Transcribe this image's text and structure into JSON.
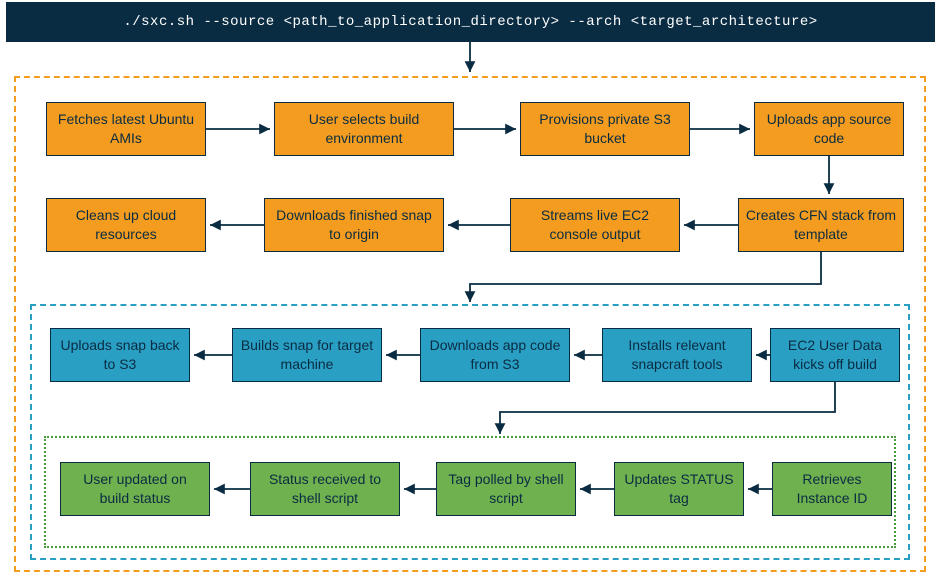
{
  "command": "./sxc.sh --source <path_to_application_directory> --arch <target_architecture>",
  "row1": {
    "b1": "Fetches latest Ubuntu AMIs",
    "b2": "User selects build environment",
    "b3": "Provisions private S3 bucket",
    "b4": "Uploads app source code"
  },
  "row2": {
    "b1": "Cleans up cloud resources",
    "b2": "Downloads finished snap to origin",
    "b3": "Streams live EC2 console output",
    "b4": "Creates CFN stack from template"
  },
  "row3": {
    "b1": "Uploads snap back to S3",
    "b2": "Builds snap for target machine",
    "b3": "Downloads app code from S3",
    "b4": "Installs relevant snapcraft tools",
    "b5": "EC2 User Data kicks off build"
  },
  "row4": {
    "b1": "User updated on build status",
    "b2": "Status received to shell script",
    "b3": "Tag polled by shell script",
    "b4": "Updates STATUS tag",
    "b5": "Retrieves Instance ID"
  }
}
